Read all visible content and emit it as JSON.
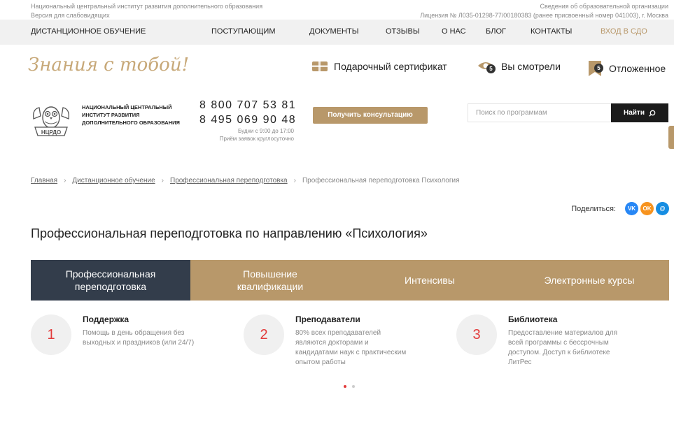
{
  "topline": {
    "org_full": "Национальный центральный институт развития дополнительного образования",
    "accessibility": "Версия для слабовидящих",
    "edu_info": "Сведения об образовательной организации",
    "license": "Лицензия № Л035-01298-77/00180383 (ранее присвоенный номер 041003), г. Москва"
  },
  "nav": {
    "items": [
      "ДИСТАНЦИОННОЕ ОБУЧЕНИЕ",
      "ПОСТУПАЮЩИМ",
      "ДОКУМЕНТЫ",
      "ОТЗЫВЫ",
      "О НАС",
      "БЛОГ",
      "КОНТАКТЫ"
    ],
    "login": "ВХОД В СДО"
  },
  "brand": {
    "slogan": "Знания с тобой!",
    "gift": "Подарочный сертификат",
    "viewed": "Вы смотрели",
    "viewed_count": "5",
    "saved": "Отложенное",
    "saved_count": "5"
  },
  "header": {
    "org_name": "НАЦИОНАЛЬНЫЙ ЦЕНТРАЛЬНЫЙ ИНСТИТУТ РАЗВИТИЯ ДОПОЛНИТЕЛЬНОГО ОБРАЗОВАНИЯ",
    "logo_text": "НЦРДО",
    "phone1": "8 800 707 53 81",
    "phone2": "8 495 069 90 48",
    "hours1": "Будни с 9:00 до 17:00",
    "hours2": "Приём заявок круглосуточно",
    "consult": "Получить консультацию",
    "search_placeholder": "Поиск по программам",
    "search_button": "Найти"
  },
  "breadcrumb": {
    "home": "Главная",
    "distance": "Дистанционное обучение",
    "retraining": "Профессиональная переподготовка",
    "current": "Профессиональная переподготовка Психология"
  },
  "share": {
    "label": "Поделиться:",
    "vk": "VK",
    "ok": "OK",
    "mail": "@"
  },
  "page": {
    "title": "Профессиональная переподготовка по направлению «Психология»"
  },
  "tabs": [
    "Профессиональная переподготовка",
    "Повышение квалификации",
    "Интенсивы",
    "Электронные курсы"
  ],
  "features": [
    {
      "num": "1",
      "title": "Поддержка",
      "text": "Помощь в день обращения без выходных и праздников (или 24/7)"
    },
    {
      "num": "2",
      "title": "Преподаватели",
      "text": "80% всех преподавателей являются докторами и кандидатами наук с практическим опытом работы"
    },
    {
      "num": "3",
      "title": "Библиотека",
      "text": "Предоставление материалов для всей программы с бессрочным доступом. Доступ к библиотеке ЛитРес"
    }
  ],
  "colors": {
    "accent": "#b8986a",
    "tab_active": "#333d4b",
    "number_red": "#e23b3b",
    "vk": "#2787f5",
    "ok": "#f7931e",
    "mail": "#168de2"
  }
}
